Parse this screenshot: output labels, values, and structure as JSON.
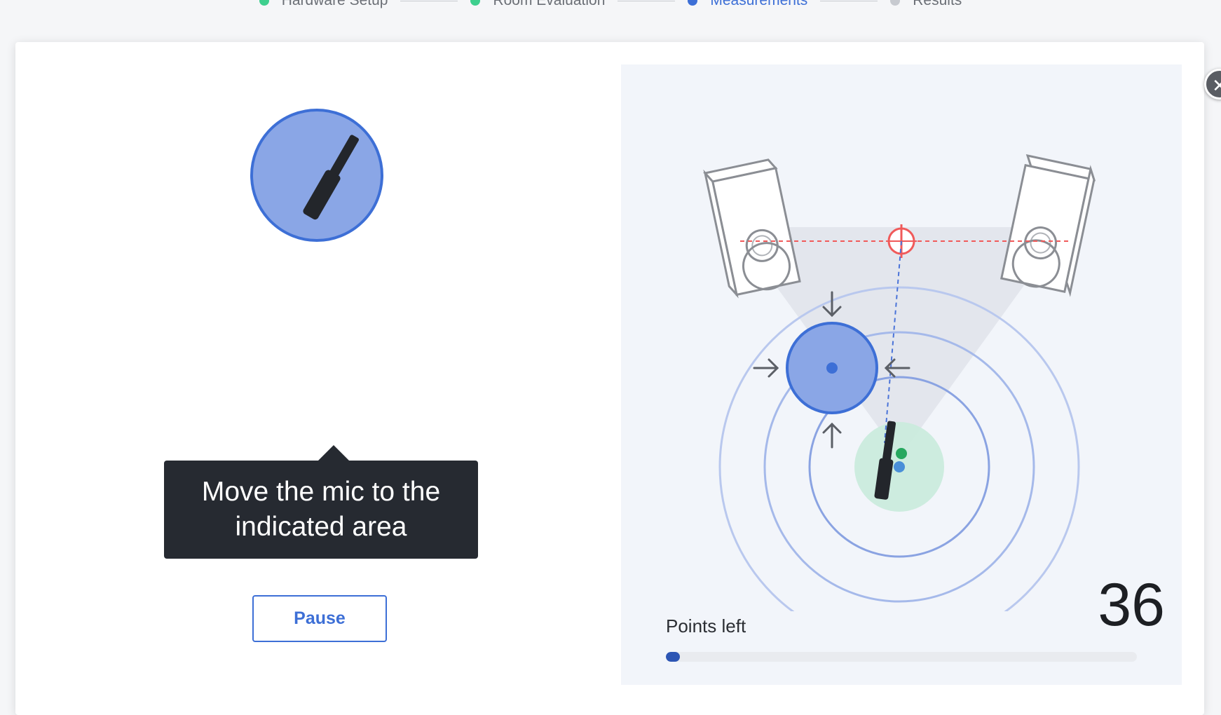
{
  "stepper": {
    "steps": [
      {
        "label": "Hardware Setup",
        "status": "complete",
        "color": "#3ecf8e"
      },
      {
        "label": "Room Evaluation",
        "status": "complete",
        "color": "#3ecf8e"
      },
      {
        "label": "Measurements",
        "status": "active",
        "color": "#3d6fd6"
      },
      {
        "label": "Results",
        "status": "pending",
        "color": "#c7cad0"
      }
    ]
  },
  "modal": {
    "close_icon": "close-icon",
    "close_glyph": "✕"
  },
  "left": {
    "tooltip_text": "Move the mic to the indicated area",
    "pause_label": "Pause"
  },
  "right": {
    "points_left_label": "Points left",
    "points_left_value": "36",
    "progress_fraction": 0.03
  },
  "colors": {
    "accent": "#3d6fd6",
    "target_fill": "#8aa6e6",
    "success": "#27a85f",
    "crosshair": "#f05a5a"
  }
}
